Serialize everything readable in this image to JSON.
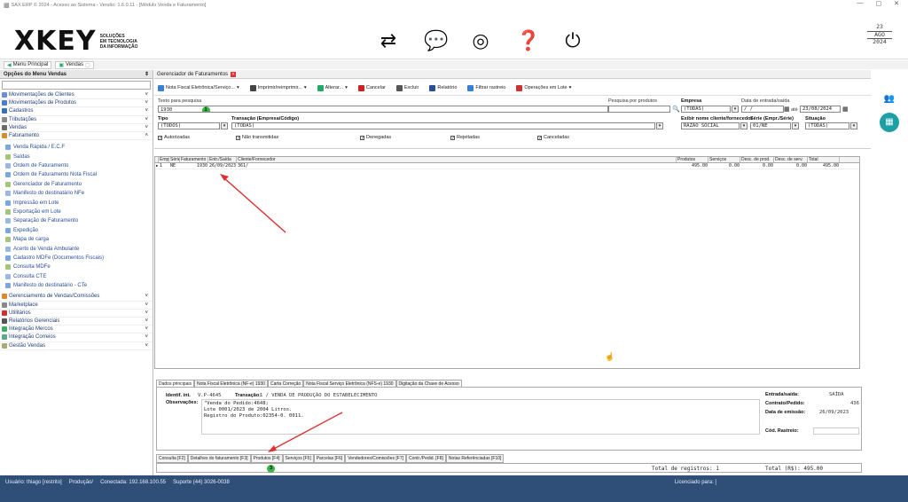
{
  "window": {
    "title": "SAX ERP © 2024 - Acesso ao Sistema - Versão: 1.6.0.11 - [Módulo Venda e Faturamento]",
    "min": "—",
    "max": "▢",
    "close": "✕"
  },
  "logo": {
    "mark": "XKEY",
    "sub1": "SOLUÇÕES",
    "sub2": "EM TECNOLOGIA",
    "sub3": "DA INFORMAÇÃO"
  },
  "date": {
    "day": "23",
    "month": "AGO",
    "year": "2024"
  },
  "tabs": {
    "menu": "Menu Principal",
    "sales": "Vendas"
  },
  "left": {
    "title": "Opções do Menu Vendas",
    "groups": [
      "Movimentações de Clientes",
      "Movimentações de Produtos",
      "Cadastros",
      "Tributações",
      "Vendas",
      "Faturamento"
    ],
    "sub": [
      "Venda Rápida / E.C.F",
      "Saídas",
      "Ordem de Faturamento",
      "Ordem de Faturamento Nota Fiscal",
      "Gerenciador de Faturamento",
      "Manifesto do destinatário NFe",
      "Impressão em Lote",
      "Exportação em Lote",
      "Separação de Faturamento",
      "Expedição",
      "Mapa de carga",
      "Acerto de Venda Ambulante",
      "Cadastro MDFe (Documentos Fiscais)",
      "Consulta MDFe",
      "Consulta CTE",
      "Manifesto do destinatário - CTe"
    ],
    "groups2": [
      "Gerenciamento de Vendas/Comissões",
      "Marketplace",
      "Utilitários",
      "Relatórios Gerenciais",
      "Integração Mercos",
      "Integração Correios",
      "Gestão Vendas"
    ]
  },
  "main": {
    "title": "Gerenciador de Faturamentos",
    "toolbar": [
      "Nota Fiscal Eletrônica/Serviço...",
      "Imprimir/reimprimir...",
      "Alterar...",
      "Cancelar",
      "Excluir",
      "Relatório",
      "Filtrar rastreio",
      "Operações em Lote"
    ],
    "form": {
      "texto_label": "Texto para pesquisa",
      "texto_val": "1930",
      "pesquisa_label": "Pesquisa por produtos",
      "empresa_label": "Empresa",
      "empresa_val": "(TODAS)",
      "data_label": "Data de entrada/saída",
      "data_from": "/  /",
      "ate": "até",
      "data_to": "23/08/2024",
      "tipo_label": "Tipo",
      "tipo_val": "(TODOS)",
      "transacao_label": "Transação (Empresa/Código)",
      "transacao_val": "(TODAS)",
      "exibir_label": "Exibir nome cliente/fornecedor",
      "exibir_val": "RAZÃO SOCIAL",
      "serie_label": "Série (Empr./Série)",
      "serie_val": "01/NE",
      "situacao_label": "Situação",
      "situacao_val": "(TODAS)",
      "checks": [
        "Autorizadas",
        "Não transmitidas",
        "Denegadas",
        "Rejeitadas",
        "Canceladas"
      ]
    },
    "grid": {
      "headers": [
        "Emp.",
        "Série",
        "Faturamento",
        "Entr./Saída",
        "Cliente/Fornecedor",
        "Produtos",
        "Serviços",
        "Desc. de prod.",
        "Desc. de serv.",
        "Total"
      ],
      "row": [
        "1",
        "NE",
        "1930",
        "26/09/2023",
        "361/",
        "495.00",
        "0.00",
        "0.00",
        "0.00",
        "495.00"
      ]
    },
    "ptabs": [
      "Dados principais",
      "Nota Fiscal Eletrônica (NF-e) 1930",
      "Carta Correção",
      "Nota Fiscal Serviço Eletrônica (NFS-e) 1930",
      "Digitação da Chave de Acesso"
    ],
    "details": {
      "ident_label": "Identif. int.",
      "ident_val": "V.P-4645",
      "trans_label": "Transação:",
      "trans_val": "1 / VENDA DE PRODUÇÃO DO ESTABELECIMENTO",
      "obs_label": "Observações:",
      "obs1": "\"Venda do Pedido:4648;",
      "obs2": "Lote 0001/2023 de 2004 Litros.",
      "obs3": "Registro do Produto:02354-0.   0011.",
      "es_label": "Entrada/saída:",
      "es_val": "SAÍDA",
      "cp_label": "Contrato/Pedido:",
      "cp_val": "436",
      "em_label": "Data de emissão:",
      "em_val": "26/09/2023",
      "cr_label": "Cód. Rastreio:"
    },
    "btabs": [
      "Consulta [F2]",
      "Detalhes do faturamento [F3]",
      "Produtos [F4]",
      "Serviços [F5]",
      "Parcelas [F6]",
      "Vendedores/Comissões [F7]",
      "Contr./Pedid. [F8]",
      "Notas Referênciadas [F10]"
    ],
    "total_reg": "Total de registros: 1",
    "total_rs": "Total (R$): 495.00"
  },
  "badges": [
    "1",
    "2",
    "3"
  ],
  "status": {
    "user": "Usuário: thiago [restrito]",
    "prod": "Produção/",
    "con": "Conectada: 192.168.100.55",
    "sup": "Suporte (44) 3026-0038",
    "lic": "Licenciado para: ["
  }
}
